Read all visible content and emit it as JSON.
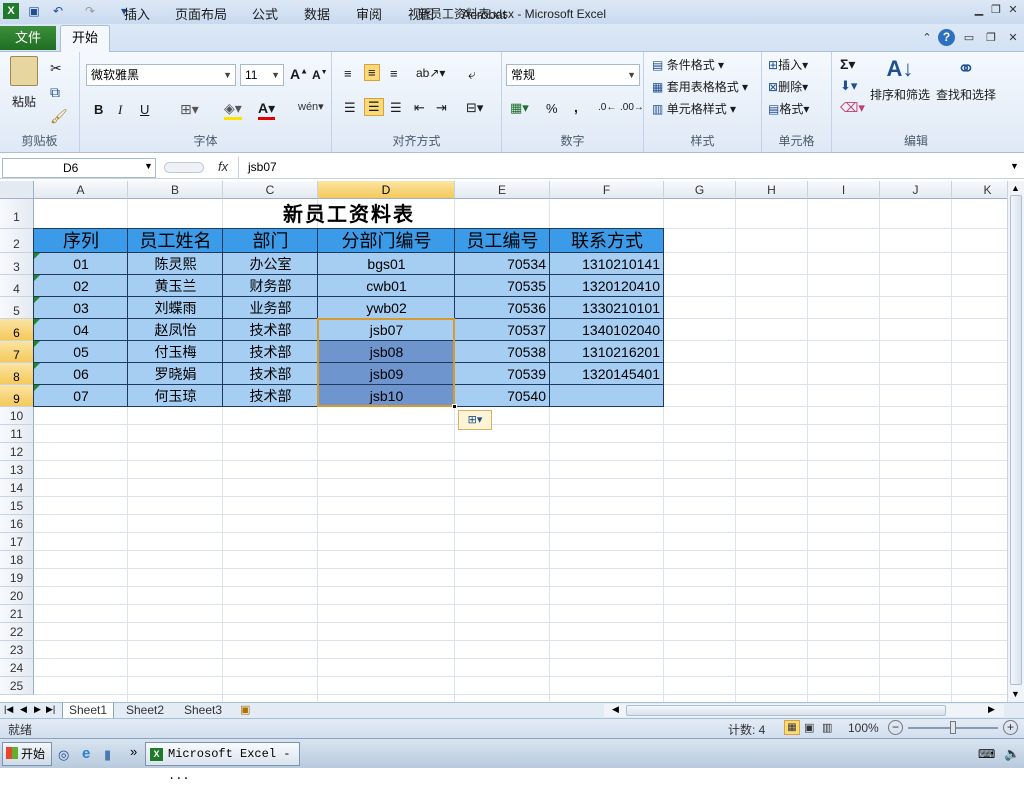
{
  "window": {
    "title": "新员工资料表.xlsx  -  Microsoft Excel"
  },
  "tabs": [
    {
      "label": "文件"
    },
    {
      "label": "开始"
    },
    {
      "label": "插入"
    },
    {
      "label": "页面布局"
    },
    {
      "label": "公式"
    },
    {
      "label": "数据"
    },
    {
      "label": "审阅"
    },
    {
      "label": "视图"
    },
    {
      "label": "Acrobat"
    }
  ],
  "ribbon": {
    "clipboard": {
      "paste": "粘贴",
      "group": "剪贴板"
    },
    "font": {
      "name": "微软雅黑",
      "size": "11",
      "group": "字体",
      "bold": "B",
      "italic": "I",
      "underline": "U"
    },
    "alignment": {
      "group": "对齐方式"
    },
    "number": {
      "format": "常规",
      "group": "数字",
      "percent": "%",
      "comma": ","
    },
    "styles": {
      "conditional": "条件格式",
      "table": "套用表格格式",
      "cell": "单元格样式",
      "group": "样式"
    },
    "cells": {
      "insert": "插入",
      "delete": "删除",
      "format": "格式",
      "group": "单元格"
    },
    "editing": {
      "sort": "排序和筛选",
      "find": "查找和选择",
      "group": "编辑"
    }
  },
  "formula_bar": {
    "name_box": "D6",
    "fx": "fx",
    "content": "jsb07"
  },
  "columns": [
    "A",
    "B",
    "C",
    "D",
    "E",
    "F",
    "G",
    "H",
    "I",
    "J",
    "K"
  ],
  "rows": [
    "1",
    "2",
    "3",
    "4",
    "5",
    "6",
    "7",
    "8",
    "9",
    "10",
    "11",
    "12",
    "13",
    "14",
    "15",
    "16",
    "17",
    "18",
    "19",
    "20",
    "21",
    "22",
    "23",
    "24",
    "25"
  ],
  "sheet": {
    "title": "新员工资料表",
    "headers": [
      "序列",
      "员工姓名",
      "部门",
      "分部门编号",
      "员工编号",
      "联系方式"
    ],
    "data": [
      [
        "01",
        "陈灵熙",
        "办公室",
        "bgs01",
        "70534",
        "1310210141"
      ],
      [
        "02",
        "黄玉兰",
        "财务部",
        "cwb01",
        "70535",
        "1320120410"
      ],
      [
        "03",
        "刘蝶雨",
        "业务部",
        "ywb02",
        "70536",
        "1330210101"
      ],
      [
        "04",
        "赵凤怡",
        "技术部",
        "jsb07",
        "70537",
        "1340102040"
      ],
      [
        "05",
        "付玉梅",
        "技术部",
        "jsb08",
        "70538",
        "1310216201"
      ],
      [
        "06",
        "罗晓娟",
        "技术部",
        "jsb09",
        "70539",
        "1320145401"
      ],
      [
        "07",
        "何玉琼",
        "技术部",
        "jsb10",
        "70540",
        ""
      ]
    ],
    "selection": "D6:D9"
  },
  "sheet_tabs": [
    {
      "label": "Sheet1"
    },
    {
      "label": "Sheet2"
    },
    {
      "label": "Sheet3"
    }
  ],
  "status": {
    "ready": "就绪",
    "count": "计数: 4",
    "zoom": "100%"
  },
  "taskbar": {
    "start": "开始",
    "excel": "Microsoft Excel - ..."
  },
  "colors": {
    "header_fill": "#3c9be8",
    "data_fill": "#a6cdf2",
    "selected_fill": "#6f95cf",
    "selection_border": "#d69a2e"
  }
}
